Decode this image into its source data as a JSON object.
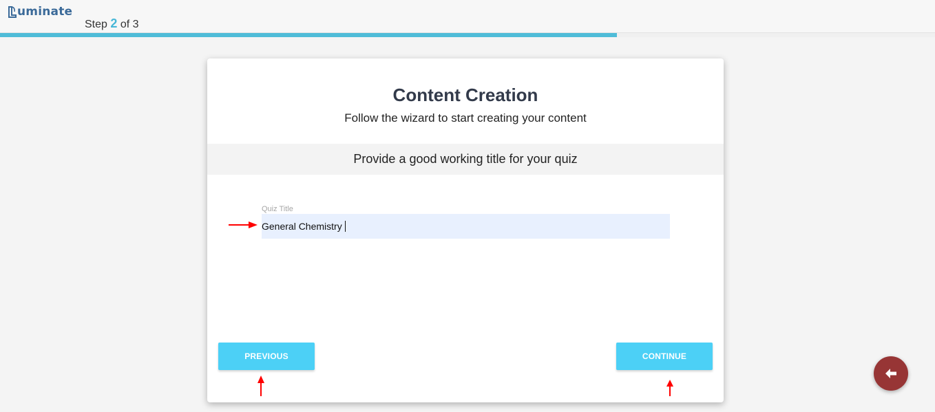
{
  "header": {
    "logo_text": "uminate",
    "step": {
      "prefix": "Step",
      "current": "2",
      "suffix": "of 3"
    },
    "progress": {
      "current_step": 2,
      "total_steps": 3,
      "fraction": 0.66
    }
  },
  "card": {
    "title": "Content Creation",
    "subtitle": "Follow the wizard to start creating your content",
    "prompt": "Provide a good working title for your quiz",
    "field": {
      "label": "Quiz Title",
      "value": "General Chemistry"
    },
    "buttons": {
      "previous": "PREVIOUS",
      "continue": "CONTINUE"
    }
  },
  "colors": {
    "brand": "#3b6a99",
    "progress": "#4fbcd8",
    "button": "#4cd0f6",
    "fab": "#973535",
    "annotation_arrow": "#ff0000"
  },
  "icons": {
    "fab": "arrow-left-icon",
    "annotation": "red-arrow-icon"
  }
}
